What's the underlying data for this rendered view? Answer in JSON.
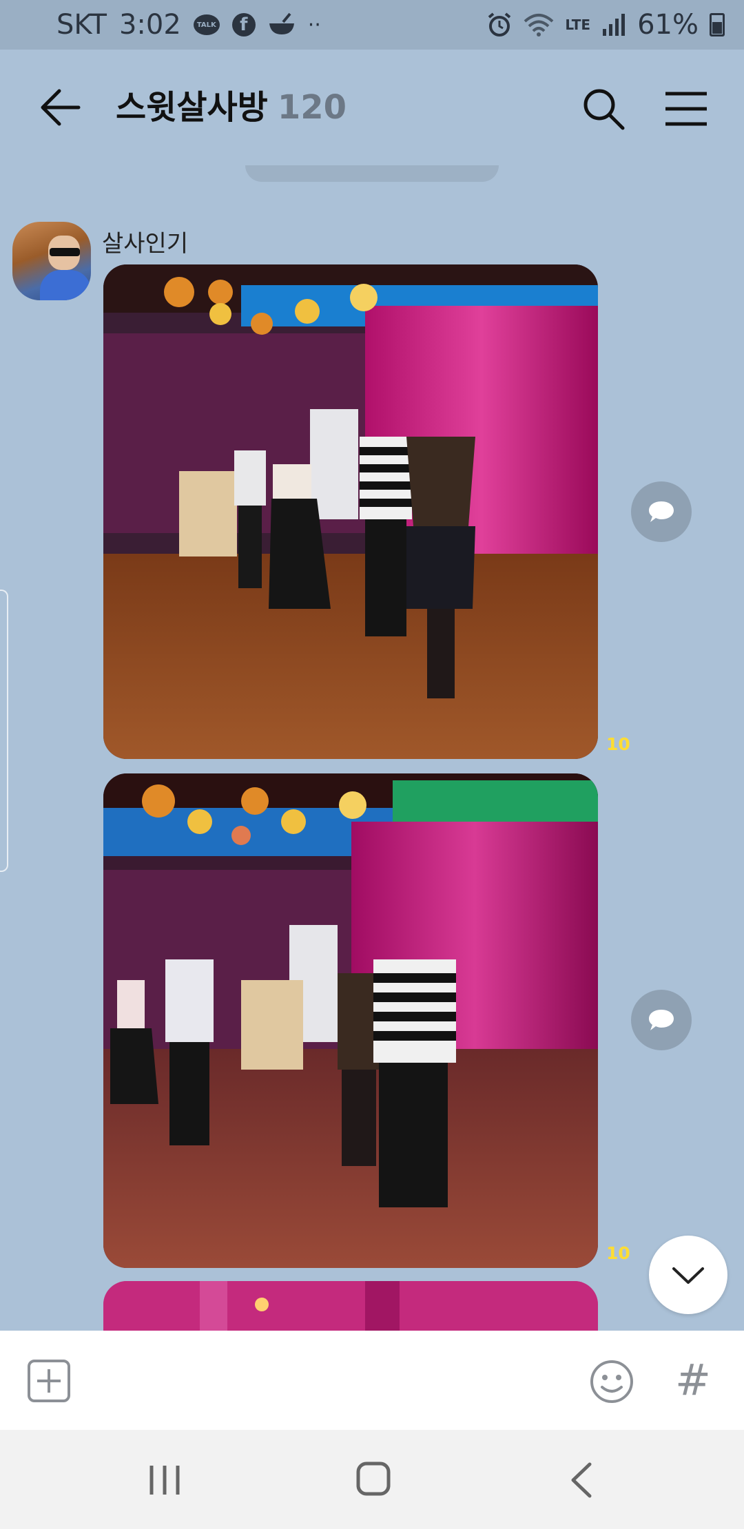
{
  "status_bar": {
    "carrier": "SKT",
    "time": "3:02",
    "talk_label": "TALK",
    "fb_label": "f",
    "network": "LTE",
    "battery": "61%"
  },
  "header": {
    "title": "스윗살사방",
    "member_count": "120"
  },
  "messages": [
    {
      "sender": "살사인기",
      "unread": "10"
    },
    {
      "unread": "10"
    }
  ],
  "input_bar": {
    "hash_label": "#"
  },
  "colors": {
    "background": "#abc1d7",
    "unread": "#ffdd33",
    "status_bar": "#9aafc4"
  },
  "icons": {
    "back": "arrow-left-icon",
    "search": "search-icon",
    "menu": "hamburger-icon",
    "share": "speech-bubble-icon",
    "scroll_down": "chevron-down-icon",
    "plus": "plus-square-icon",
    "emoji": "smiley-icon"
  }
}
